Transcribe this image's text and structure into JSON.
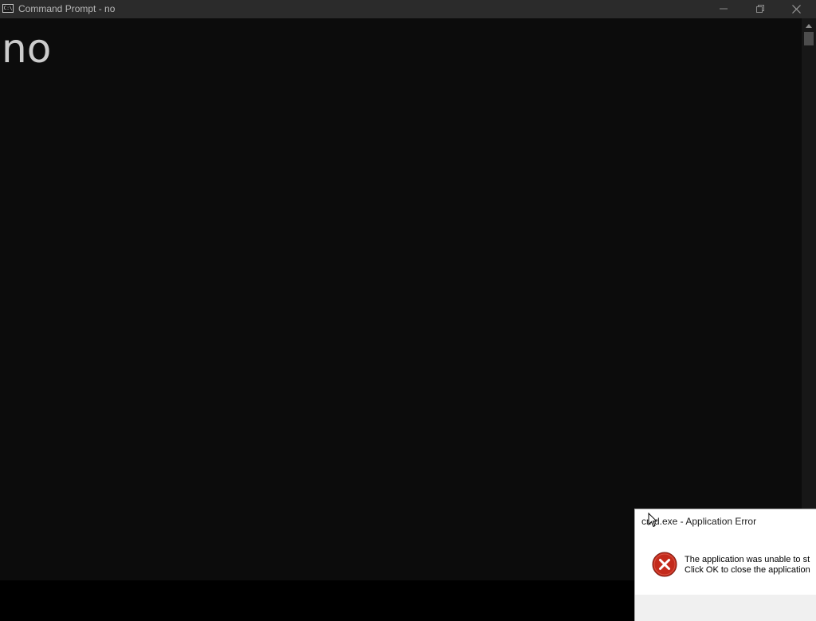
{
  "window": {
    "title": "Command Prompt - no",
    "icon": "cmd-icon",
    "icon_text": "C:\\",
    "controls": [
      "minimize-icon",
      "restore-icon",
      "close-icon"
    ]
  },
  "console": {
    "output": "no"
  },
  "dialog": {
    "title": "cmd.exe - Application Error",
    "icon": "error-icon",
    "message_line1": "The application was unable to st",
    "message_line2": "Click OK to close the application"
  },
  "colors": {
    "titlebar_bg": "#2b2b2b",
    "console_bg": "#0c0c0c",
    "console_text": "#cccccc",
    "error_red": "#c42b1c"
  }
}
